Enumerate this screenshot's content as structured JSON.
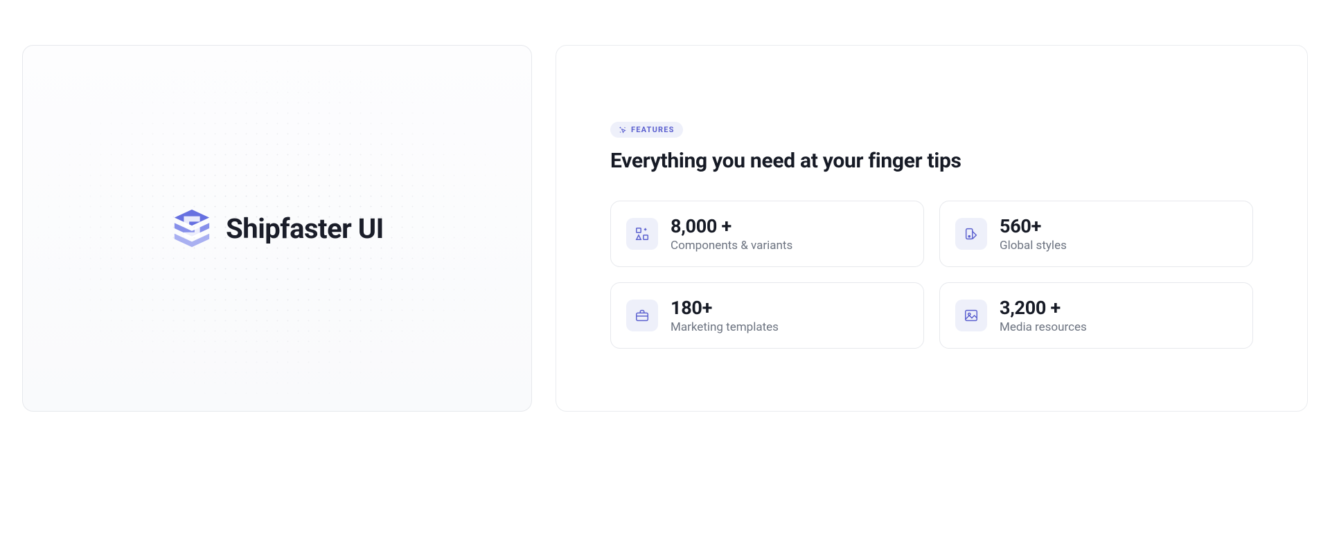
{
  "brand": {
    "name": "Shipfaster UI"
  },
  "features": {
    "badge_label": "FEATURES",
    "headline": "Everything you need at your finger tips",
    "stats": [
      {
        "value": "8,000 +",
        "label": "Components & variants",
        "icon": "shapes"
      },
      {
        "value": "560+",
        "label": "Global styles",
        "icon": "swatch"
      },
      {
        "value": "180+",
        "label": "Marketing templates",
        "icon": "briefcase"
      },
      {
        "value": "3,200 +",
        "label": "Media resources",
        "icon": "image"
      }
    ]
  },
  "colors": {
    "accent": "#5a5fcf",
    "accent_bg": "#eef0fa",
    "text_primary": "#161a25",
    "text_secondary": "#6c7380",
    "border": "#e6e8ec"
  }
}
